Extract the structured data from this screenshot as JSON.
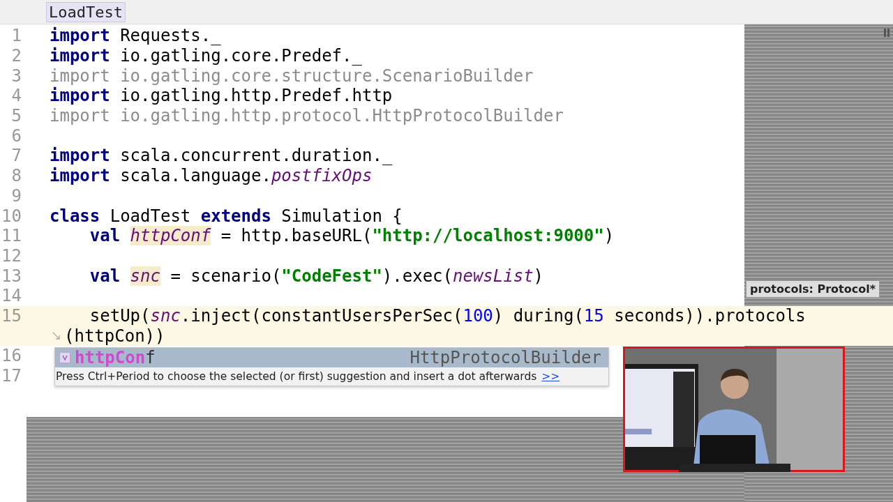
{
  "breadcrumb": "LoadTest",
  "lines": [
    {
      "number": "1",
      "tokens": [
        {
          "kind": "keyword",
          "text": "import"
        },
        {
          "kind": "plain",
          "text": " Requests._"
        }
      ]
    },
    {
      "number": "2",
      "tokens": [
        {
          "kind": "keyword",
          "text": "import"
        },
        {
          "kind": "plain",
          "text": " io.gatling.core.Predef._"
        }
      ]
    },
    {
      "number": "3",
      "tokens": [
        {
          "kind": "unused",
          "text": "import io.gatling.core.structure.ScenarioBuilder"
        }
      ]
    },
    {
      "number": "4",
      "tokens": [
        {
          "kind": "keyword",
          "text": "import"
        },
        {
          "kind": "plain",
          "text": " io.gatling.http.Predef.http"
        }
      ]
    },
    {
      "number": "5",
      "tokens": [
        {
          "kind": "unused",
          "text": "import io.gatling.http.protocol.HttpProtocolBuilder"
        }
      ]
    },
    {
      "number": "6"
    },
    {
      "number": "7",
      "tokens": [
        {
          "kind": "keyword",
          "text": "import"
        },
        {
          "kind": "plain",
          "text": " scala.concurrent.duration._"
        }
      ]
    },
    {
      "number": "8",
      "tokens": [
        {
          "kind": "keyword",
          "text": "import"
        },
        {
          "kind": "plain",
          "text": " scala.language."
        },
        {
          "kind": "member",
          "text": "postfixOps"
        }
      ]
    },
    {
      "number": "9"
    },
    {
      "number": "10",
      "tokens": [
        {
          "kind": "keyword",
          "text": "class"
        },
        {
          "kind": "plain",
          "text": " LoadTest "
        },
        {
          "kind": "keyword",
          "text": "extends"
        },
        {
          "kind": "plain",
          "text": " Simulation {"
        }
      ]
    },
    {
      "number": "11",
      "indent": true,
      "tokens": [
        {
          "kind": "keyword",
          "text": "val "
        },
        {
          "kind": "declaration",
          "text": "httpConf"
        },
        {
          "kind": "plain",
          "text": " = http.baseURL("
        },
        {
          "kind": "string",
          "text": "\"http://localhost:9000\""
        },
        {
          "kind": "plain",
          "text": ")"
        }
      ]
    },
    {
      "number": "12"
    },
    {
      "number": "13",
      "indent": true,
      "tokens": [
        {
          "kind": "keyword",
          "text": "val "
        },
        {
          "kind": "declaration",
          "text": "snc"
        },
        {
          "kind": "plain",
          "text": " = scenario("
        },
        {
          "kind": "string",
          "text": "\"CodeFest\""
        },
        {
          "kind": "plain",
          "text": ").exec("
        },
        {
          "kind": "member",
          "text": "newsList"
        },
        {
          "kind": "plain",
          "text": ")"
        }
      ]
    },
    {
      "number": "14"
    },
    {
      "number": "15",
      "indent": true,
      "tokens": [
        {
          "kind": "plain",
          "text": "setUp("
        },
        {
          "kind": "member",
          "text": "snc"
        },
        {
          "kind": "plain",
          "text": ".inject(constantUsersPerSec("
        },
        {
          "kind": "number",
          "text": "100"
        },
        {
          "kind": "plain",
          "text": ") during("
        },
        {
          "kind": "number",
          "text": "15"
        },
        {
          "kind": "plain",
          "text": " seconds)).protocols"
        }
      ],
      "wrapped": "(httpCon))",
      "current": true
    },
    {
      "number": "16"
    },
    {
      "number": "17"
    }
  ],
  "parameter_hint": "protocols: Protocol*",
  "completion": {
    "items": [
      {
        "label": "**httpCon**f",
        "type": "HttpProtocolBuilder",
        "selected": true
      }
    ],
    "hint": "Press Ctrl+Period to choose the selected (or first) suggestion and insert a dot afterwards",
    "hint_link": ">>"
  }
}
